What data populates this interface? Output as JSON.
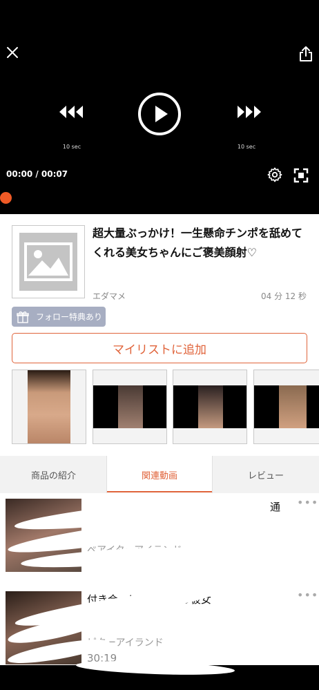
{
  "player": {
    "skip_back_label": "10 sec",
    "skip_forward_label": "10 sec",
    "time": "00:00 / 00:07",
    "accent_color": "#ef5a26"
  },
  "product": {
    "title": "超大量ぶっかけ！一生懸命チンポを舐めてくれる美女ちゃんにご褒美顔射♡",
    "maker": "エダマメ",
    "duration": "04 分 12 秒",
    "follow_badge": "フォロー特典あり",
    "mylist_button": "マイリストに追加"
  },
  "tabs": [
    {
      "label": "商品の紹介"
    },
    {
      "label": "関連動画"
    },
    {
      "label": "レビュー"
    }
  ],
  "related": [
    {
      "title": "通",
      "maker": "ペアイターアイランド",
      "duration": "",
      "more": "•••"
    },
    {
      "title": "付き合…になる最高の彼女",
      "maker": "ピターアイランド",
      "duration": "30:19",
      "more": "•••"
    }
  ],
  "icons": {
    "close": "close-icon",
    "share": "share-icon",
    "rewind": "rewind-icon",
    "play": "play-icon",
    "forward": "forward-icon",
    "settings": "gear-icon",
    "fullscreen": "fullscreen-icon",
    "gift": "gift-icon",
    "more": "more-icon"
  }
}
